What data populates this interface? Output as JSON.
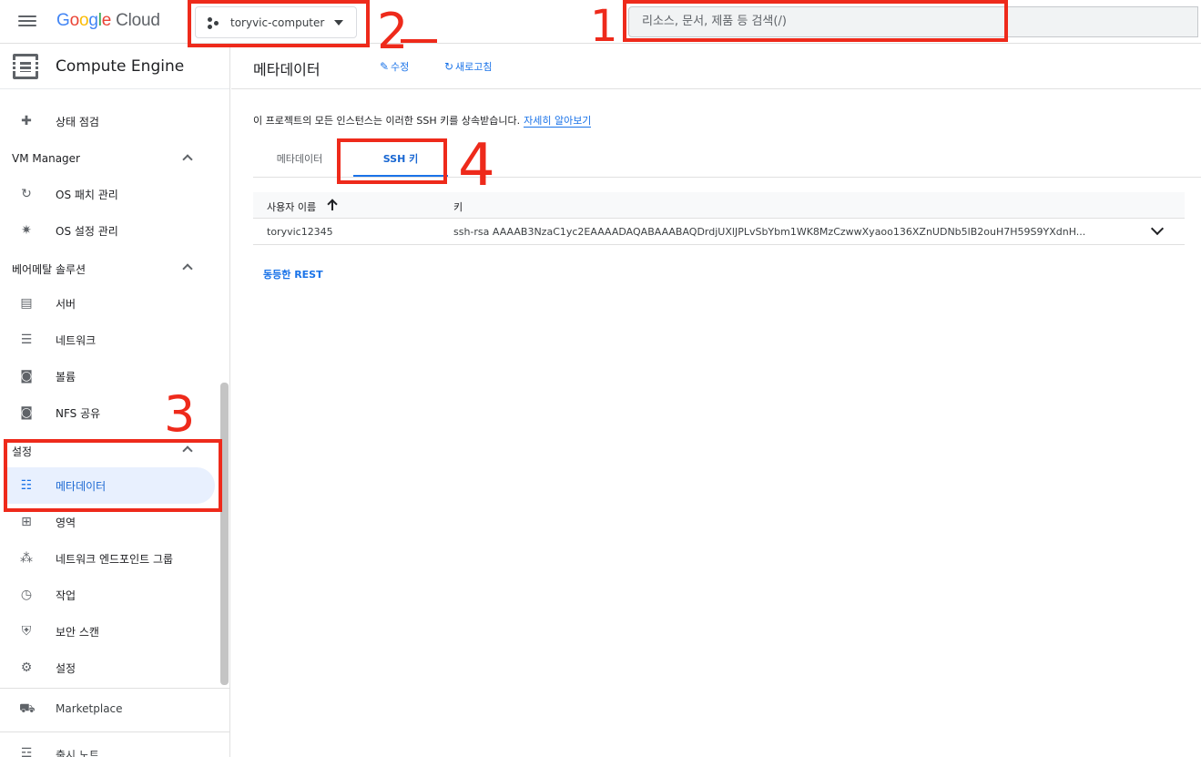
{
  "topbar": {
    "logo": {
      "google": [
        "G",
        "o",
        "o",
        "g",
        "l",
        "e"
      ],
      "product": "Cloud"
    },
    "project_name": "toryvic-computer",
    "search_placeholder": "리소스, 문서, 제품 등 검색(/)"
  },
  "sidebar": {
    "title": "Compute Engine",
    "items_top": [
      {
        "label": "상태 점검",
        "icon": "health-check-icon"
      }
    ],
    "sections": [
      {
        "label": "VM Manager",
        "items": [
          {
            "label": "OS 패치 관리",
            "icon": "patch-icon"
          },
          {
            "label": "OS 설정 관리",
            "icon": "os-config-icon"
          }
        ]
      },
      {
        "label": "베어메탈 솔루션",
        "items": [
          {
            "label": "서버",
            "icon": "server-icon"
          },
          {
            "label": "네트워크",
            "icon": "network-icon"
          },
          {
            "label": "볼륨",
            "icon": "volume-icon"
          },
          {
            "label": "NFS 공유",
            "icon": "nfs-icon"
          }
        ]
      },
      {
        "label": "설정",
        "items": [
          {
            "label": "메타데이터",
            "icon": "metadata-icon",
            "active": true
          },
          {
            "label": "영역",
            "icon": "zones-icon"
          },
          {
            "label": "네트워크 엔드포인트 그룹",
            "icon": "endpoint-group-icon"
          },
          {
            "label": "작업",
            "icon": "clock-icon"
          },
          {
            "label": "보안 스캔",
            "icon": "shield-icon"
          },
          {
            "label": "설정",
            "icon": "gear-icon"
          }
        ]
      }
    ],
    "bottom": [
      {
        "label": "Marketplace",
        "icon": "cart-icon"
      },
      {
        "label": "출시 노트",
        "icon": "release-notes-icon"
      }
    ]
  },
  "main": {
    "title": "메타데이터",
    "edit_label": "수정",
    "refresh_label": "새로고침",
    "info_text": "이 프로젝트의 모든 인스턴스는 이러한 SSH 키를 상속받습니다.",
    "learn_more": "자세히 알아보기",
    "tabs": [
      {
        "label": "메타데이터",
        "active": false
      },
      {
        "label": "SSH 키",
        "active": true
      }
    ],
    "table": {
      "columns": [
        "사용자 이름",
        "키"
      ],
      "rows": [
        {
          "user": "toryvic12345",
          "key": "ssh-rsa AAAAB3NzaC1yc2EAAAADAQABAAABAQDrdjUXlJPLvSbYbm1WK8MzCzwwXyaoo136XZnUDNb5lB2ouH7H59S9YXdnH..."
        }
      ]
    },
    "rest_label": "동등한 REST"
  },
  "annotations": {
    "color": "#ee2a1b",
    "labels": [
      "1",
      "2",
      "3",
      "4"
    ]
  }
}
